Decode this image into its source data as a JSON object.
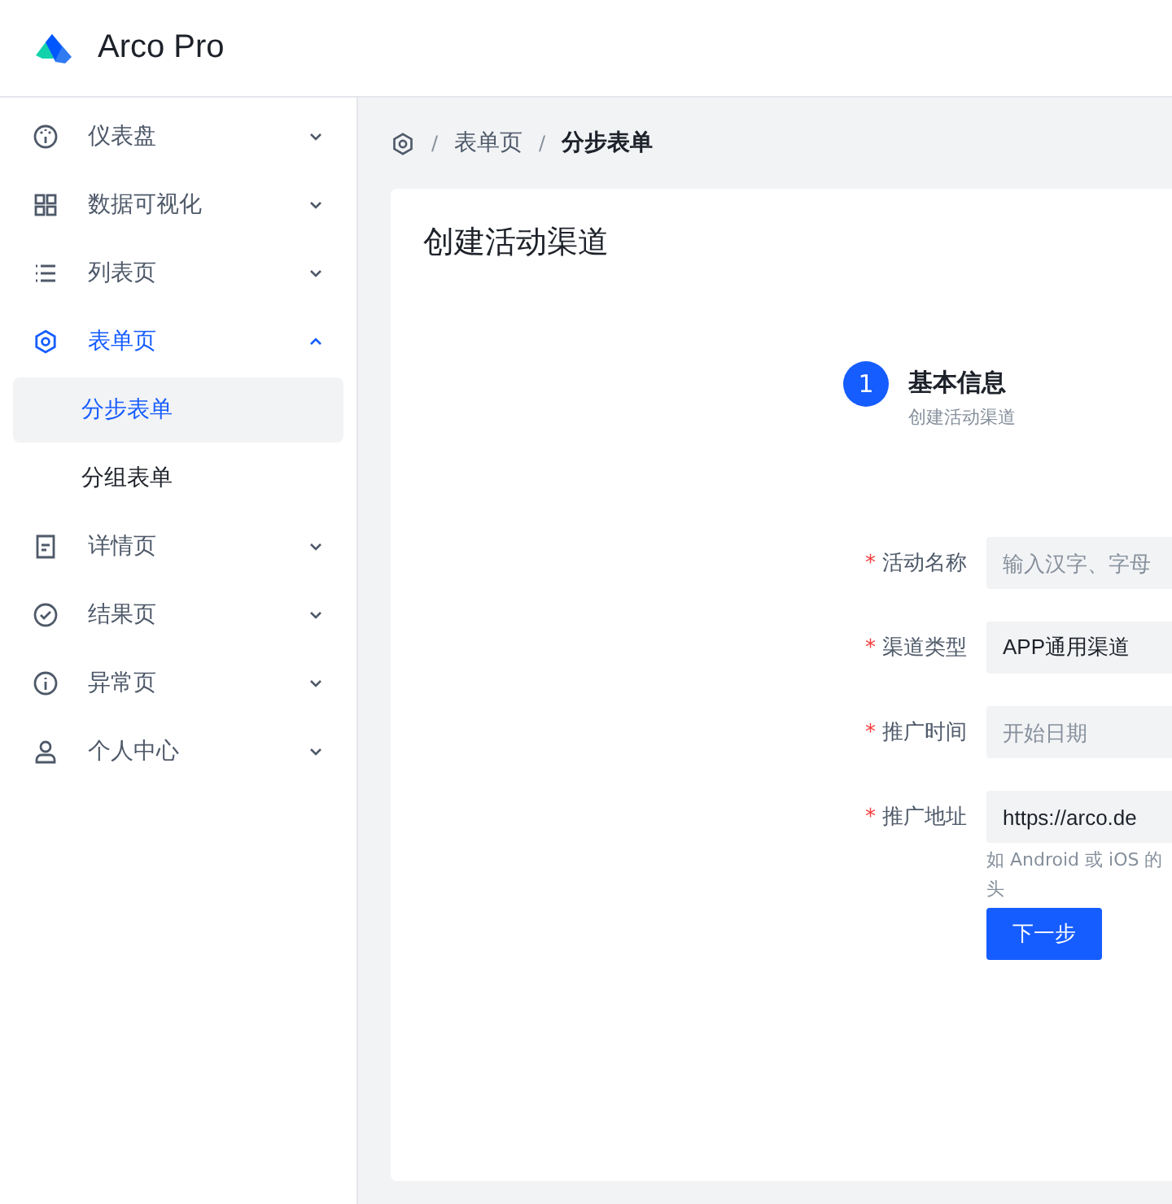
{
  "header": {
    "title": "Arco Pro"
  },
  "menu": [
    {
      "label": "仪表盘",
      "expanded": false
    },
    {
      "label": "数据可视化",
      "expanded": false
    },
    {
      "label": "列表页",
      "expanded": false
    },
    {
      "label": "表单页",
      "expanded": true,
      "children": [
        {
          "label": "分步表单",
          "selected": true
        },
        {
          "label": "分组表单",
          "selected": false
        }
      ]
    },
    {
      "label": "详情页",
      "expanded": false
    },
    {
      "label": "结果页",
      "expanded": false
    },
    {
      "label": "异常页",
      "expanded": false
    },
    {
      "label": "个人中心",
      "expanded": false
    }
  ],
  "breadcrumb": [
    {
      "separator": "/",
      "label": "表单页"
    },
    {
      "separator": "/",
      "label": "分步表单"
    }
  ],
  "card": {
    "title": "创建活动渠道",
    "steps": [
      {
        "number": "1",
        "title": "基本信息",
        "description": "创建活动渠道",
        "selected": true
      }
    ],
    "form": [
      {
        "label": "活动名称",
        "required_mark": "*",
        "placeholder": "输入汉字、字母"
      },
      {
        "label": "渠道类型",
        "required_mark": "*",
        "value": "APP通用渠道"
      },
      {
        "label": "推广时间",
        "required_mark": "*",
        "placeholder": "开始日期"
      },
      {
        "label": "推广地址",
        "required_mark": "*",
        "value": "https://arco.de",
        "help_lines": [
          "如 Android 或 iOS 的",
          "头"
        ]
      }
    ],
    "button": "下一步"
  }
}
